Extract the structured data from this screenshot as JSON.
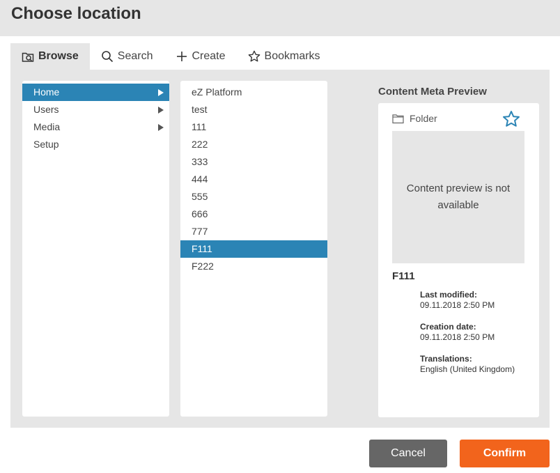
{
  "dialog": {
    "title": "Choose location"
  },
  "tabs": [
    {
      "label": "Browse",
      "icon": "browse-icon",
      "active": true
    },
    {
      "label": "Search",
      "icon": "search-icon",
      "active": false
    },
    {
      "label": "Create",
      "icon": "plus-icon",
      "active": false
    },
    {
      "label": "Bookmarks",
      "icon": "star-icon",
      "active": false
    }
  ],
  "tree": {
    "column1": [
      {
        "label": "Home",
        "selected": true,
        "has_children": true
      },
      {
        "label": "Users",
        "selected": false,
        "has_children": true
      },
      {
        "label": "Media",
        "selected": false,
        "has_children": true
      },
      {
        "label": "Setup",
        "selected": false,
        "has_children": false
      }
    ],
    "column2": [
      {
        "label": "eZ Platform",
        "selected": false
      },
      {
        "label": "test",
        "selected": false
      },
      {
        "label": "111",
        "selected": false
      },
      {
        "label": "222",
        "selected": false
      },
      {
        "label": "333",
        "selected": false
      },
      {
        "label": "444",
        "selected": false
      },
      {
        "label": "555",
        "selected": false
      },
      {
        "label": "666",
        "selected": false
      },
      {
        "label": "777",
        "selected": false
      },
      {
        "label": "F111",
        "selected": true
      },
      {
        "label": "F222",
        "selected": false
      }
    ]
  },
  "preview": {
    "heading": "Content Meta Preview",
    "content_type": "Folder",
    "content_type_icon": "folder-icon",
    "bookmark_icon": "star-outline-icon",
    "placeholder": "Content preview is not available",
    "name": "F111",
    "last_modified_label": "Last modified:",
    "last_modified": "09.11.2018 2:50 PM",
    "creation_date_label": "Creation date:",
    "creation_date": "09.11.2018 2:50 PM",
    "translations_label": "Translations:",
    "translations": "English (United Kingdom)"
  },
  "footer": {
    "cancel_label": "Cancel",
    "confirm_label": "Confirm"
  },
  "colors": {
    "selected": "#2b84b5",
    "confirm": "#f2641c",
    "cancel": "#666666",
    "accent_star": "#2b84b5"
  }
}
